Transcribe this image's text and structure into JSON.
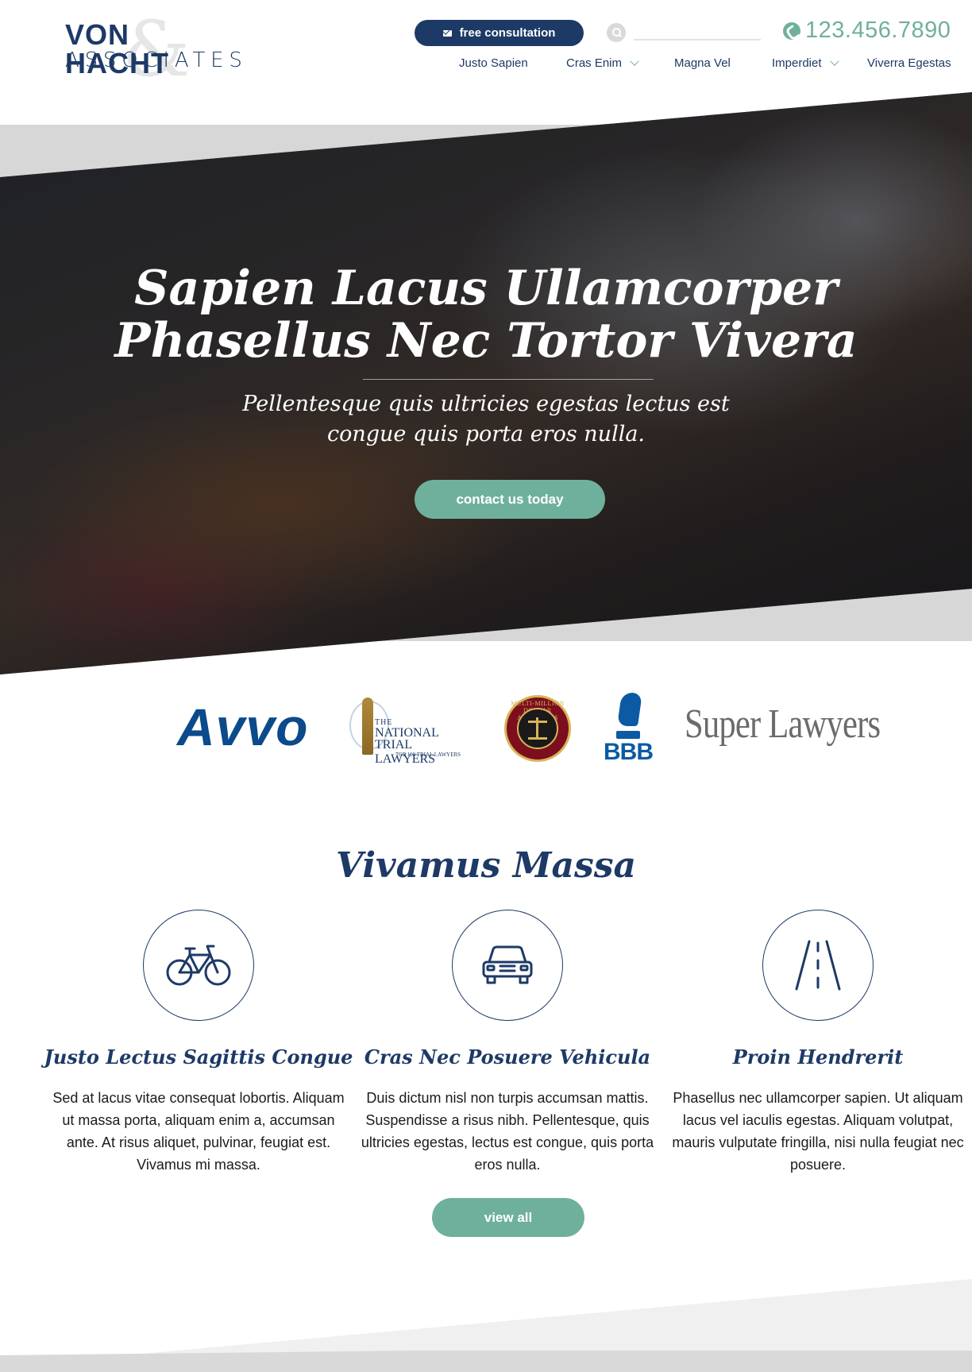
{
  "header": {
    "logo": {
      "line1": "VON HACHT",
      "line2": "ASSOCIATES",
      "ampersand": "&"
    },
    "consult_label": "free consultation",
    "search": {
      "placeholder": "",
      "value": ""
    },
    "phone": "123.456.7890",
    "nav": [
      {
        "label": "Justo Sapien",
        "has_dropdown": false
      },
      {
        "label": "Cras Enim",
        "has_dropdown": true
      },
      {
        "label": "Magna Vel",
        "has_dropdown": false
      },
      {
        "label": "Imperdiet",
        "has_dropdown": true
      },
      {
        "label": "Viverra Egestas",
        "has_dropdown": false
      }
    ]
  },
  "hero": {
    "title_line1": "Sapien Lacus Ullamcorper",
    "title_line2": "Phasellus Nec Tortor Vivera",
    "subtitle_line1": "Pellentesque quis ultricies egestas lectus est",
    "subtitle_line2": "congue quis porta eros nulla.",
    "cta_label": "contact us today"
  },
  "badges": {
    "avvo": "Avvo",
    "ntl": {
      "the": "THE",
      "line1": "NATIONAL",
      "line2": "TRIAL LAWYERS",
      "line3": "TOP 100 TRIAL LAWYERS"
    },
    "mmdaf": "MULTI-MILLION DOLLAR ADVOCATES FORUM",
    "bbb": "BBB",
    "superlawyers": "Super Lawyers"
  },
  "practice": {
    "title": "Vivamus Massa",
    "cards": [
      {
        "icon": "bicycle-icon",
        "title": "Justo Lectus Sagittis Congue",
        "text": "Sed at lacus vitae consequat lobortis. Aliquam ut massa porta, aliquam enim a, accumsan ante. At risus aliquet, pulvinar, feugiat est. Vivamus mi massa."
      },
      {
        "icon": "car-icon",
        "title": "Cras Nec Posuere Vehicula",
        "text": "Duis dictum nisl non turpis accumsan mattis. Suspendisse a risus nibh. Pellentesque, quis ultricies egestas, lectus est congue, quis porta eros nulla."
      },
      {
        "icon": "road-icon",
        "title": "Proin Hendrerit",
        "text": "Phasellus nec ullamcorper sapien. Ut aliquam lacus vel iaculis egestas. Aliquam volutpat, mauris vulputate fringilla, nisi nulla feugiat nec posuere."
      }
    ],
    "view_all_label": "view all"
  },
  "colors": {
    "navy": "#1d3a66",
    "accent": "#6fb09c",
    "hero_band": "#d7d7d7"
  }
}
